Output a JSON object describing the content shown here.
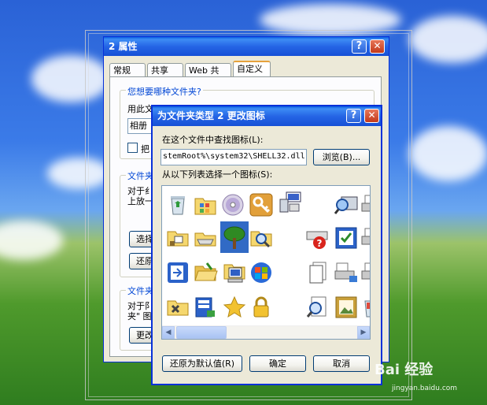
{
  "background_window": {
    "title": "2 属性",
    "tabs": [
      "常规",
      "共享",
      "Web 共享",
      "自定义"
    ],
    "active_tab": "自定义",
    "group1_title": "您想要哪种文件夹?",
    "use_this_label": "用此文",
    "template_value": "相册",
    "checkbox_label": "把",
    "group2_title": "文件夹",
    "group2_text_line1": "对于纟",
    "group2_text_line2": "上放一",
    "choose_picture_button": "选择",
    "restore_default_button": "还原",
    "group3_title": "文件夹",
    "group3_text_line1": "对于阝",
    "group3_text_line2": "夹\" 图",
    "change_icon_button": "更改"
  },
  "dialog": {
    "title": "为文件夹类型 2 更改图标",
    "look_for_label": "在这个文件中查找图标(L):",
    "path_value": "stemRoot%\\system32\\SHELL32.dll",
    "browse_button": "浏览(B)...",
    "select_label": "从以下列表选择一个图标(S):",
    "restore_default_button": "还原为默认值(R)",
    "ok_button": "确定",
    "cancel_button": "取消",
    "icons": [
      "recycle-bin-icon",
      "control-panel-icon",
      "cd-disc-icon",
      "key-icon",
      "network-computer-icon",
      "",
      "search-computer-icon",
      "printer-icon",
      "folder-network-icon",
      "drive-icon",
      "tree-icon",
      "folder-search-icon",
      "",
      "network-help-icon",
      "checklist-icon",
      "printer-icon",
      "recent-documents-icon",
      "open-folder-icon",
      "my-computer-icon",
      "windows-logo-icon",
      "",
      "documents-stack-icon",
      "fax-printer-icon",
      "printer-icon",
      "folder-tools-icon",
      "taskbar-icon",
      "star-icon",
      "lock-icon",
      "",
      "magnifier-document-icon",
      "picture-frame-icon",
      "recycle-full-icon"
    ],
    "selected_index": 10
  },
  "watermark": {
    "brand": "Bai 经验",
    "url": "jingyan.baidu.com"
  },
  "colors": {
    "titlebar": "#2565e5",
    "dialog_face": "#ece9d8",
    "group_title": "#0046d5",
    "selection": "#316ac5"
  }
}
